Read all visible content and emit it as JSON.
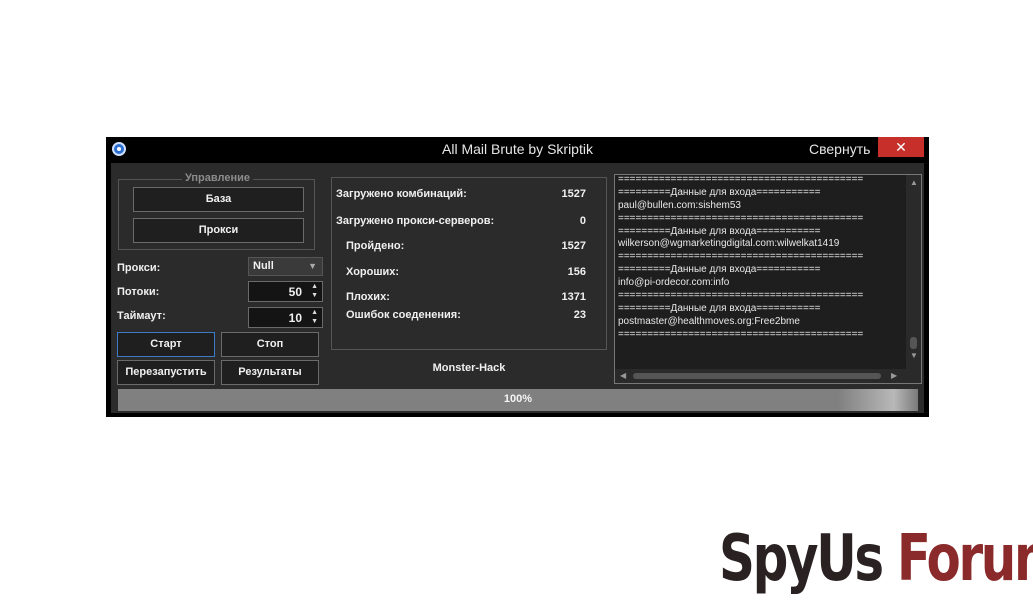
{
  "window": {
    "title": "All Mail Brute  by Skriptik",
    "minimize_label": "Свернуть",
    "close_icon": "✕"
  },
  "controls": {
    "group_title": "Управление",
    "base_button": "База",
    "proxy_button": "Прокси",
    "proxy_label": "Прокси:",
    "proxy_select_value": "Null",
    "threads_label": "Потоки:",
    "threads_value": "50",
    "timeout_label": "Таймаут:",
    "timeout_value": "10",
    "start_button": "Старт",
    "stop_button": "Стоп",
    "restart_button": "Перезапустить",
    "results_button": "Результаты"
  },
  "stats": {
    "loaded_combos_label": "Загружено комбинаций:",
    "loaded_combos_value": "1527",
    "loaded_proxies_label": "Загружено прокси-серверов:",
    "loaded_proxies_value": "0",
    "passed_label": "Пройдено:",
    "passed_value": "1527",
    "good_label": "Хороших:",
    "good_value": "156",
    "bad_label": "Плохих:",
    "bad_value": "1371",
    "errors_label": "Ошибок соеденения:",
    "errors_value": "23"
  },
  "credit": "Monster-Hack",
  "log": [
    "==========================================",
    "=========Данные для входа===========",
    "paul@bullen.com:sishem53",
    "==========================================",
    "=========Данные для входа===========",
    "wilkerson@wgmarketingdigital.com:wilwelkat1419",
    "==========================================",
    "=========Данные для входа===========",
    "info@pi-ordecor.com:info",
    "==========================================",
    "=========Данные для входа===========",
    "postmaster@healthmoves.org:Free2bme",
    "=========================================="
  ],
  "progress": {
    "percent": 100,
    "label": "100%"
  },
  "watermark": {
    "text_part1": "SpyUs",
    "text_part2": " Forum"
  },
  "colors": {
    "title_bg": "#000000",
    "client_bg": "#2b2b2b",
    "close_bg": "#c7302a",
    "progress_fill": "#808080"
  }
}
